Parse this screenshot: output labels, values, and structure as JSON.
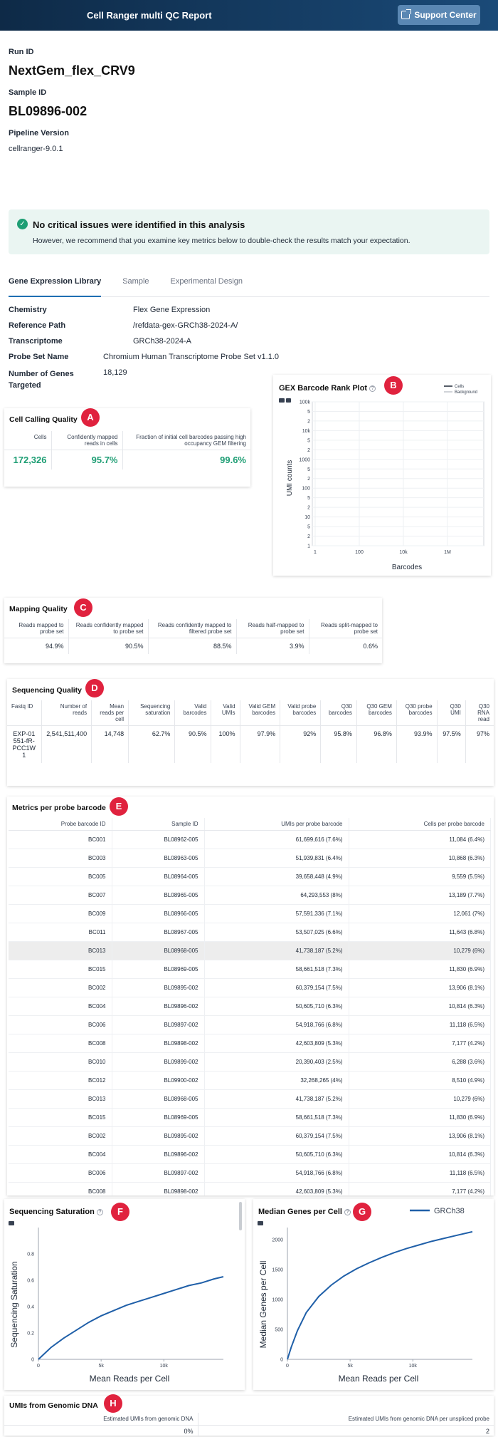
{
  "header": {
    "title": "Cell Ranger multi QC Report",
    "support_label": "Support Center"
  },
  "meta": {
    "run_id_label": "Run ID",
    "run_id": "NextGem_flex_CRV9",
    "sample_id_label": "Sample ID",
    "sample_id": "BL09896-002",
    "pipeline_label": "Pipeline Version",
    "pipeline": "cellranger-9.0.1"
  },
  "alert": {
    "title": "No critical issues were identified in this analysis",
    "text": "However, we recommend that you examine key metrics below to double-check the results match your expectation."
  },
  "tabs": [
    "Gene Expression Library",
    "Sample",
    "Experimental Design"
  ],
  "library_info": [
    {
      "k": "Chemistry",
      "v": "Flex Gene Expression"
    },
    {
      "k": "Reference Path",
      "v": "/refdata-gex-GRCh38-2024-A/"
    },
    {
      "k": "Transcriptome",
      "v": "GRCh38-2024-A"
    },
    {
      "k": "Probe Set Name",
      "v": "Chromium Human Transcriptome Probe Set v1.1.0"
    },
    {
      "k": "Number of Genes Targeted",
      "v": "18,129"
    }
  ],
  "badges": [
    "A",
    "B",
    "C",
    "D",
    "E",
    "F",
    "G",
    "H"
  ],
  "cell_calling": {
    "title": "Cell Calling Quality",
    "headers": [
      "Cells",
      "Confidently mapped reads in cells",
      "Fraction of initial cell barcodes passing high occupancy GEM filtering"
    ],
    "values": [
      "172,326",
      "95.7%",
      "99.6%"
    ]
  },
  "barcode_rank": {
    "title": "GEX Barcode Rank Plot",
    "legend": [
      "Cells",
      "Background"
    ],
    "ylabel": "UMI counts",
    "xlabel": "Barcodes",
    "yticks": [
      "100k",
      "5",
      "2",
      "10k",
      "5",
      "2",
      "1000",
      "5",
      "2",
      "100",
      "5",
      "2",
      "10",
      "5",
      "2",
      "1"
    ],
    "xticks": [
      "1",
      "100",
      "10k",
      "1M"
    ]
  },
  "mapping": {
    "title": "Mapping Quality",
    "headers": [
      "Reads mapped to probe set",
      "Reads confidently mapped to probe set",
      "Reads confidently mapped to filtered probe set",
      "Reads half-mapped to probe set",
      "Reads split-mapped to probe set"
    ],
    "values": [
      "94.9%",
      "90.5%",
      "88.5%",
      "3.9%",
      "0.6%"
    ]
  },
  "sequencing": {
    "title": "Sequencing Quality",
    "headers": [
      "Fastq ID",
      "Number of reads",
      "Mean reads per cell",
      "Sequencing saturation",
      "Valid barcodes",
      "Valid UMIs",
      "Valid GEM barcodes",
      "Valid probe barcodes",
      "Q30 barcodes",
      "Q30 GEM barcodes",
      "Q30 probe barcodes",
      "Q30 UMI",
      "Q30 RNA read"
    ],
    "values": [
      "EXP-01551-fR-PCC1W1",
      "2,541,511,400",
      "14,748",
      "62.7%",
      "90.5%",
      "100%",
      "97.9%",
      "92%",
      "95.8%",
      "96.8%",
      "93.9%",
      "97.5%",
      "97%"
    ]
  },
  "per_probe": {
    "title": "Metrics per probe barcode",
    "headers": [
      "Probe barcode ID",
      "Sample ID",
      "UMIs per probe barcode",
      "Cells per probe barcode"
    ],
    "rows": [
      [
        "BC001",
        "BL08962-005",
        "61,699,616 (7.6%)",
        "11,084 (6.4%)"
      ],
      [
        "BC003",
        "BL08963-005",
        "51,939,831 (6.4%)",
        "10,868 (6.3%)"
      ],
      [
        "BC005",
        "BL08964-005",
        "39,658,448 (4.9%)",
        "9,559 (5.5%)"
      ],
      [
        "BC007",
        "BL08965-005",
        "64,293,553 (8%)",
        "13,189 (7.7%)"
      ],
      [
        "BC009",
        "BL08966-005",
        "57,591,336 (7.1%)",
        "12,061 (7%)"
      ],
      [
        "BC011",
        "BL08967-005",
        "53,507,025 (6.6%)",
        "11,643 (6.8%)"
      ],
      [
        "BC013",
        "BL08968-005",
        "41,738,187 (5.2%)",
        "10,279 (6%)"
      ],
      [
        "BC015",
        "BL08969-005",
        "58,661,518 (7.3%)",
        "11,830 (6.9%)"
      ],
      [
        "BC002",
        "BL09895-002",
        "60,379,154 (7.5%)",
        "13,906 (8.1%)"
      ],
      [
        "BC004",
        "BL09896-002",
        "50,605,710 (6.3%)",
        "10,814 (6.3%)"
      ],
      [
        "BC006",
        "BL09897-002",
        "54,918,766 (6.8%)",
        "11,118 (6.5%)"
      ],
      [
        "BC008",
        "BL09898-002",
        "42,603,809 (5.3%)",
        "7,177 (4.2%)"
      ],
      [
        "BC010",
        "BL09899-002",
        "20,390,403 (2.5%)",
        "6,288 (3.6%)"
      ],
      [
        "BC012",
        "BL09900-002",
        "32,268,265 (4%)",
        "8,510 (4.9%)"
      ],
      [
        "BC013",
        "BL08968-005",
        "41,738,187 (5.2%)",
        "10,279 (6%)"
      ],
      [
        "BC015",
        "BL08969-005",
        "58,661,518 (7.3%)",
        "11,830 (6.9%)"
      ],
      [
        "BC002",
        "BL09895-002",
        "60,379,154 (7.5%)",
        "13,906 (8.1%)"
      ],
      [
        "BC004",
        "BL09896-002",
        "50,605,710 (6.3%)",
        "10,814 (6.3%)"
      ],
      [
        "BC006",
        "BL09897-002",
        "54,918,766 (6.8%)",
        "11,118 (6.5%)"
      ],
      [
        "BC008",
        "BL09898-002",
        "42,603,809 (5.3%)",
        "7,177 (4.2%)"
      ]
    ],
    "highlight_row": 6
  },
  "saturation": {
    "title": "Sequencing Saturation"
  },
  "median_genes": {
    "title": "Median Genes per Cell"
  },
  "genomic": {
    "title": "UMIs from Genomic DNA",
    "headers": [
      "Estimated UMIs from genomic DNA",
      "Estimated UMIs from genomic DNA per unspliced probe"
    ],
    "values": [
      "0%",
      "2"
    ]
  },
  "chart_data": [
    {
      "type": "line",
      "title": "Sequencing Saturation",
      "xlabel": "Mean Reads per Cell",
      "ylabel": "Sequencing Saturation",
      "xlim": [
        0,
        14748
      ],
      "ylim": [
        0,
        1
      ],
      "xticks": [
        0,
        5000,
        10000
      ],
      "xtick_labels": [
        "0",
        "5k",
        "10k"
      ],
      "yticks": [
        0,
        0.2,
        0.4,
        0.6,
        0.8
      ],
      "ytick_labels": [
        "0",
        "0.2",
        "0.4",
        "0.6",
        "0.8"
      ],
      "x": [
        0,
        1000,
        2000,
        3000,
        4000,
        5000,
        6000,
        7000,
        8000,
        9000,
        10000,
        11000,
        12000,
        13000,
        14000,
        14748
      ],
      "y": [
        0,
        0.09,
        0.16,
        0.22,
        0.28,
        0.33,
        0.37,
        0.41,
        0.44,
        0.47,
        0.5,
        0.53,
        0.56,
        0.58,
        0.61,
        0.627
      ],
      "color": "#1f5fa8"
    },
    {
      "type": "line",
      "title": "Median Genes per Cell",
      "xlabel": "Mean Reads per Cell",
      "ylabel": "Median Genes per Cell",
      "series_name": "GRCh38",
      "xlim": [
        0,
        14748
      ],
      "ylim": [
        0,
        2200
      ],
      "xticks": [
        0,
        5000,
        10000
      ],
      "xtick_labels": [
        "0",
        "5k",
        "10k"
      ],
      "yticks": [
        0,
        500,
        1000,
        1500,
        2000
      ],
      "ytick_labels": [
        "0",
        "500",
        "1000",
        "1500",
        "2000"
      ],
      "x": [
        0,
        300,
        800,
        1500,
        2500,
        3500,
        4500,
        5500,
        6500,
        7500,
        8500,
        9500,
        10500,
        11500,
        12500,
        13500,
        14748
      ],
      "y": [
        0,
        200,
        480,
        780,
        1050,
        1240,
        1390,
        1510,
        1610,
        1700,
        1780,
        1850,
        1910,
        1970,
        2020,
        2070,
        2130
      ],
      "color": "#1f5fa8"
    }
  ]
}
